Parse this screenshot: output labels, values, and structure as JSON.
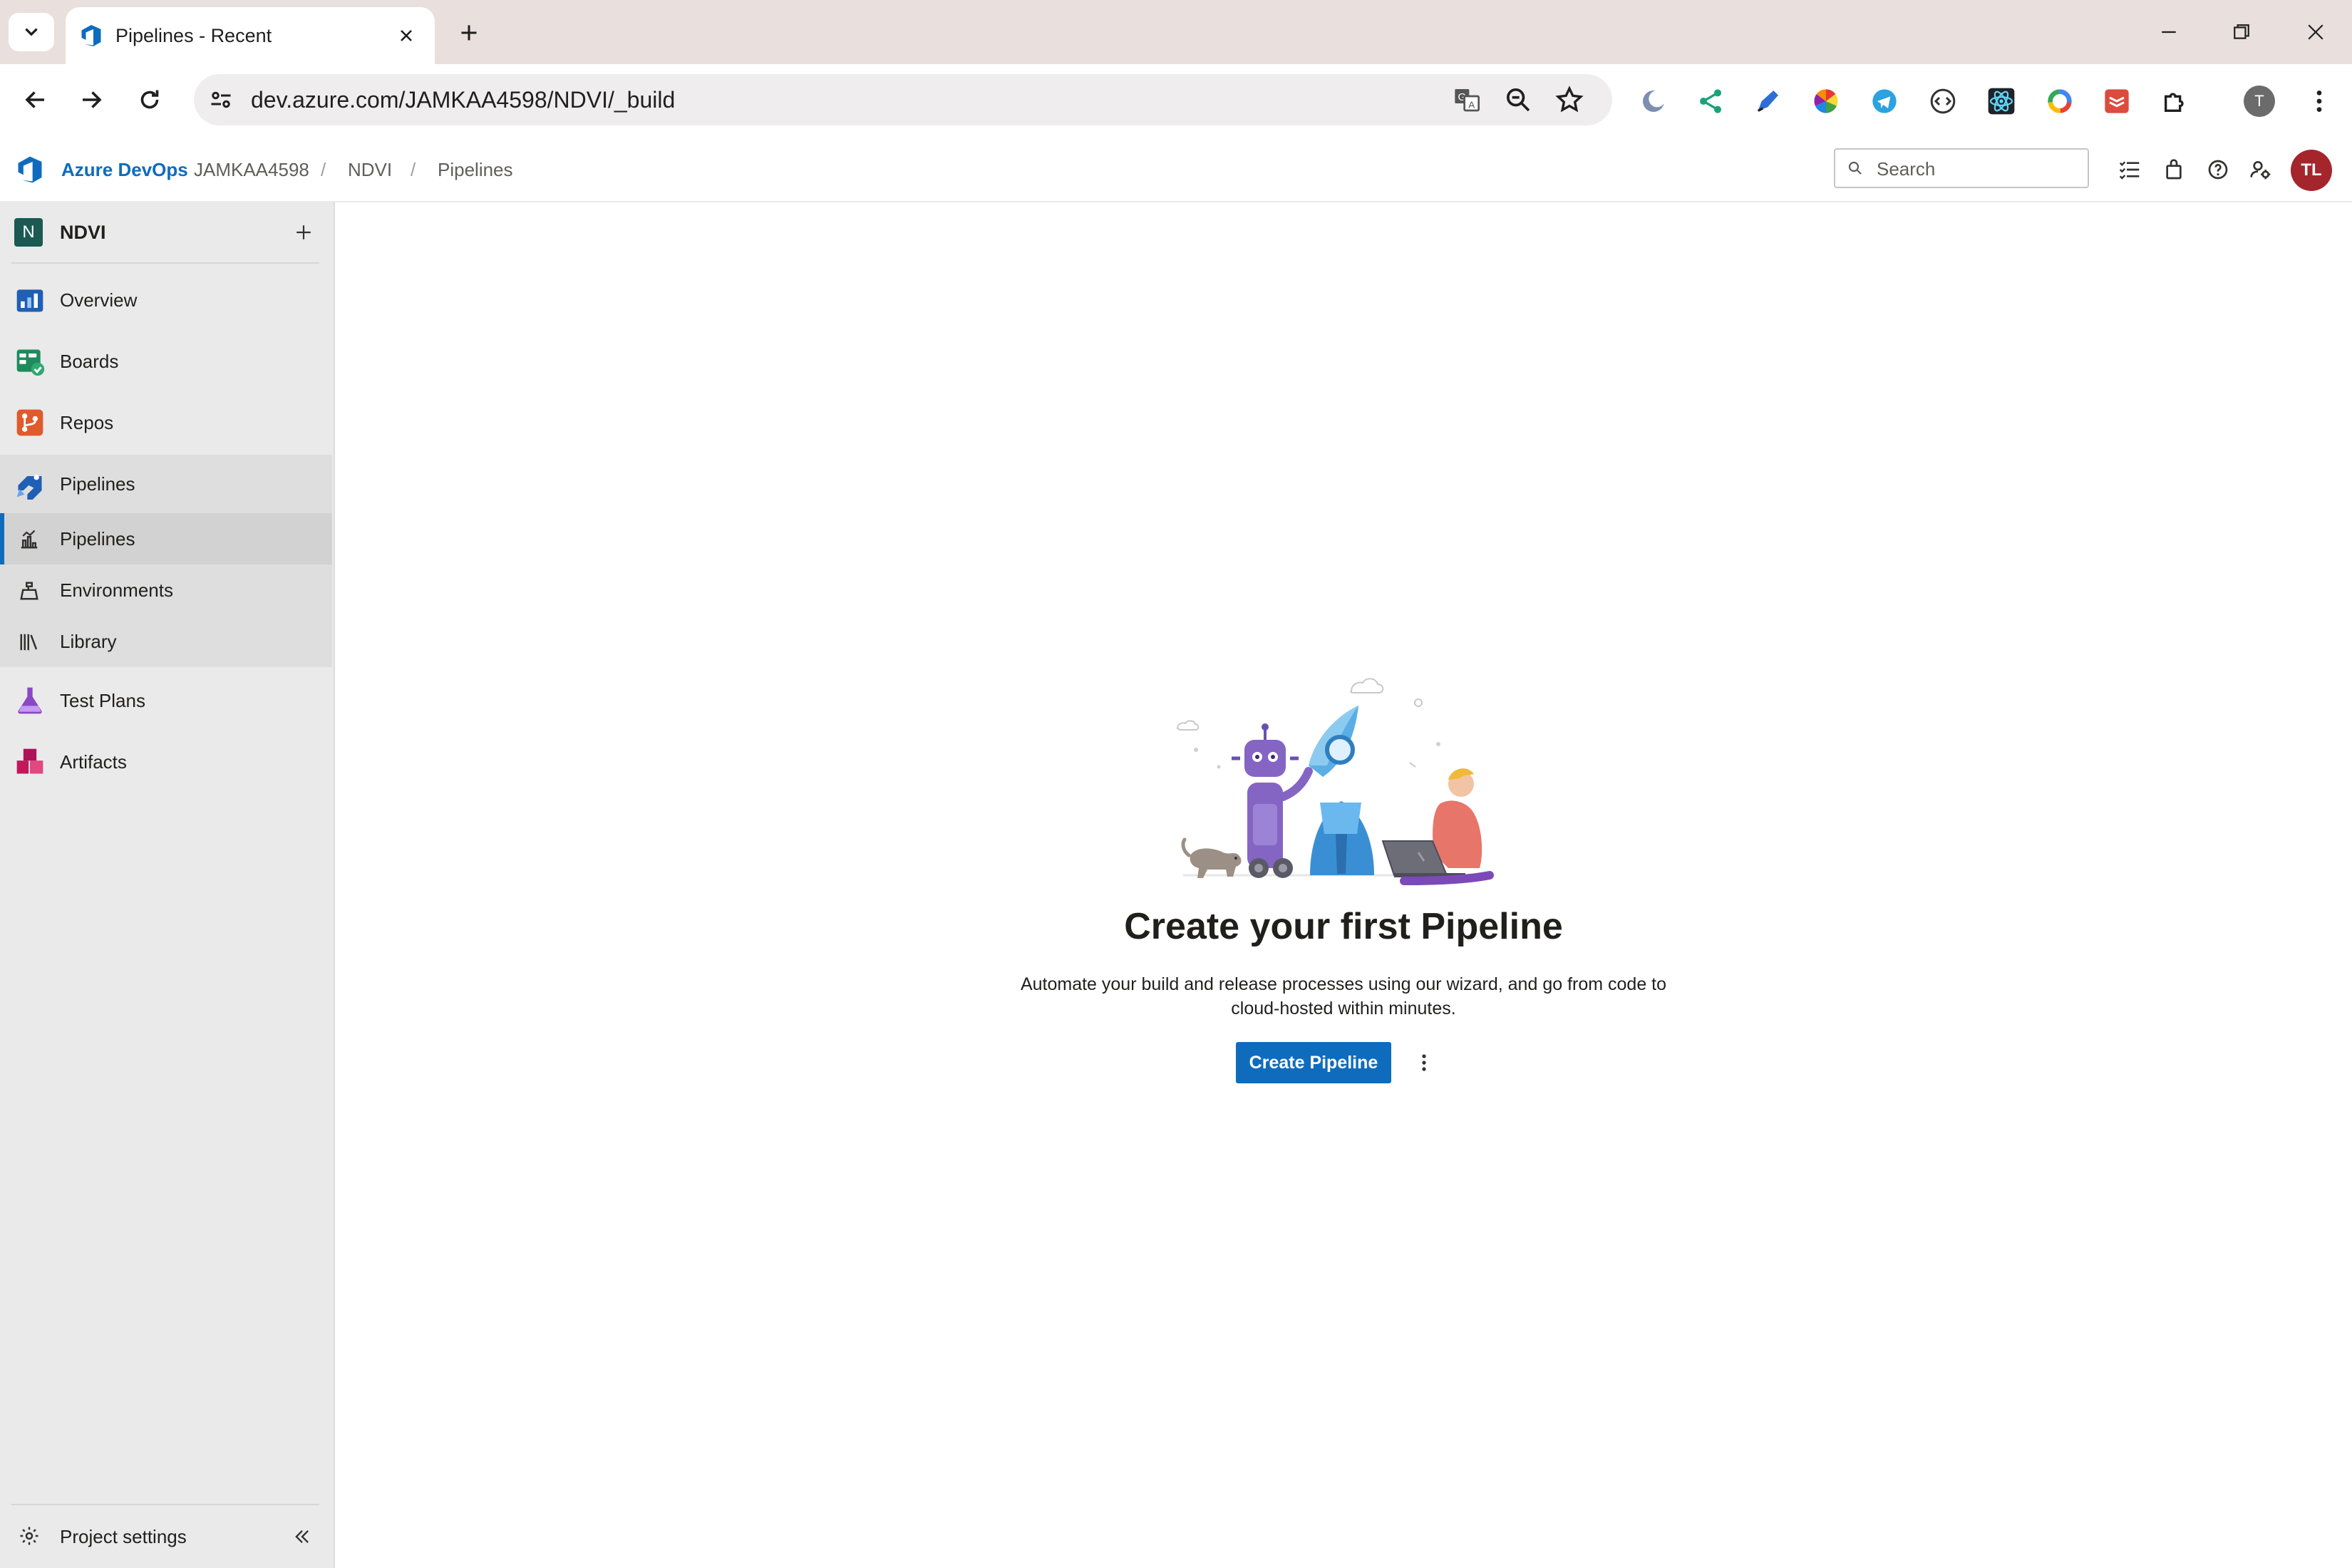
{
  "browser": {
    "tab_title": "Pipelines - Recent",
    "url": "dev.azure.com/JAMKAA4598/NDVI/_build",
    "profile_initial": "T"
  },
  "header": {
    "brand": "Azure DevOps",
    "breadcrumb": [
      "JAMKAA4598",
      "NDVI",
      "Pipelines"
    ],
    "search_placeholder": "Search",
    "avatar_initials": "TL"
  },
  "sidebar": {
    "project_initial": "N",
    "project_name": "NDVI",
    "items": [
      {
        "label": "Overview",
        "icon": "overview-icon"
      },
      {
        "label": "Boards",
        "icon": "boards-icon"
      },
      {
        "label": "Repos",
        "icon": "repos-icon"
      },
      {
        "label": "Pipelines",
        "icon": "pipelines-icon"
      },
      {
        "label": "Test Plans",
        "icon": "test-plans-icon"
      },
      {
        "label": "Artifacts",
        "icon": "artifacts-icon"
      }
    ],
    "subitems": [
      {
        "label": "Pipelines",
        "icon": "pipelines-sub-icon"
      },
      {
        "label": "Environments",
        "icon": "environments-icon"
      },
      {
        "label": "Library",
        "icon": "library-icon"
      }
    ],
    "project_settings": "Project settings"
  },
  "main": {
    "title": "Create your first Pipeline",
    "description": "Automate your build and release processes using our wizard, and go from code to cloud-hosted within minutes.",
    "create_button": "Create Pipeline"
  },
  "colors": {
    "accent": "#0f6cbd",
    "avatar": "#a4262c",
    "project_badge": "#1a5a52"
  }
}
